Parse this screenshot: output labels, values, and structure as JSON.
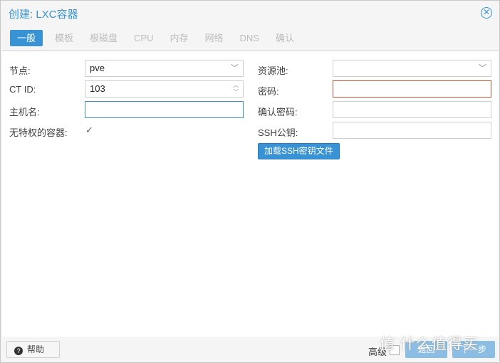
{
  "window": {
    "title": "创建: LXC容器"
  },
  "tabs": [
    "一般",
    "模板",
    "根磁盘",
    "CPU",
    "内存",
    "网络",
    "DNS",
    "确认"
  ],
  "form": {
    "node_label": "节点:",
    "node_value": "pve",
    "ctid_label": "CT ID:",
    "ctid_value": "103",
    "hostname_label": "主机名:",
    "hostname_value": "",
    "unpriv_label": "无特权的容器:",
    "unpriv_checked": true,
    "pool_label": "资源池:",
    "pool_value": "",
    "password_label": "密码:",
    "password_value": "",
    "confirm_label": "确认密码:",
    "confirm_value": "",
    "ssh_label": "SSH公钥:",
    "ssh_value": "",
    "load_ssh_button": "加载SSH密钥文件"
  },
  "footer": {
    "help": "帮助",
    "advanced": "高级",
    "back": "返回",
    "next": "下一步"
  },
  "watermark": "什么值得买",
  "colors": {
    "accent": "#3892d4",
    "error": "#cf4c35"
  }
}
